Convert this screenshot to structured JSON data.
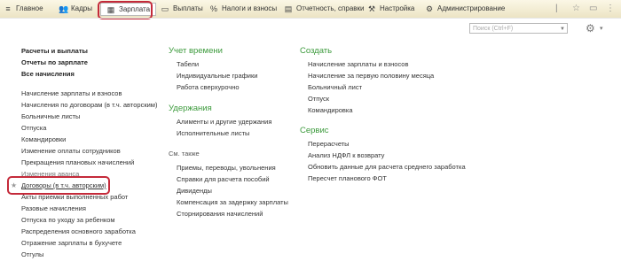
{
  "tabs": [
    {
      "label": "Главное",
      "icon": "home-icon"
    },
    {
      "label": "Кадры",
      "icon": "people-icon"
    },
    {
      "label": "Зарплата",
      "icon": "calculator-icon",
      "active": true
    },
    {
      "label": "Выплаты",
      "icon": "cash-icon"
    },
    {
      "label": "Налоги и взносы",
      "icon": "percent-icon"
    },
    {
      "label": "Отчетность, справки",
      "icon": "report-icon"
    },
    {
      "label": "Настройка",
      "icon": "wrench-icon"
    },
    {
      "label": "Администрирование",
      "icon": "gear-icon"
    }
  ],
  "search": {
    "placeholder": "Поиск (Ctrl+F)"
  },
  "col1": {
    "bold_items": [
      "Расчеты и выплаты",
      "Отчеты по зарплате",
      "Все начисления"
    ],
    "items": [
      "Начисление зарплаты и взносов",
      "Начисления по договорам (в т.ч. авторским)",
      "Больничные листы",
      "Отпуска",
      "Командировки",
      "Изменение оплаты сотрудников",
      "Прекращения плановых начислений",
      "Изменения аванса",
      "Договоры (в т.ч. авторским)",
      "Акты приемки выполненных работ",
      "Разовые начисления",
      "Отпуска по уходу за ребенком",
      "Распределения основного заработка",
      "Отражение зарплаты в бухучете",
      "Отгулы"
    ]
  },
  "col2": {
    "time_header": "Учет времени",
    "time_items": [
      "Табели",
      "Индивидуальные графики",
      "Работа сверхурочно"
    ],
    "ded_header": "Удержания",
    "ded_items": [
      "Алименты и другие удержания",
      "Исполнительные листы"
    ],
    "see_also": "См. также",
    "see_items": [
      "Приемы, переводы, увольнения",
      "Справки для расчета пособий",
      "Дивиденды",
      "Компенсация за задержку зарплаты",
      "Сторнирования начислений"
    ]
  },
  "col3": {
    "create_header": "Создать",
    "create_items": [
      "Начисление зарплаты и взносов",
      "Начисление за первую половину месяца",
      "Больничный лист",
      "Отпуск",
      "Командировка"
    ],
    "service_header": "Сервис",
    "service_items": [
      "Перерасчеты",
      "Анализ НДФЛ к возврату",
      "Обновить данные для расчета среднего заработка",
      "Пересчет планового ФОТ"
    ]
  }
}
